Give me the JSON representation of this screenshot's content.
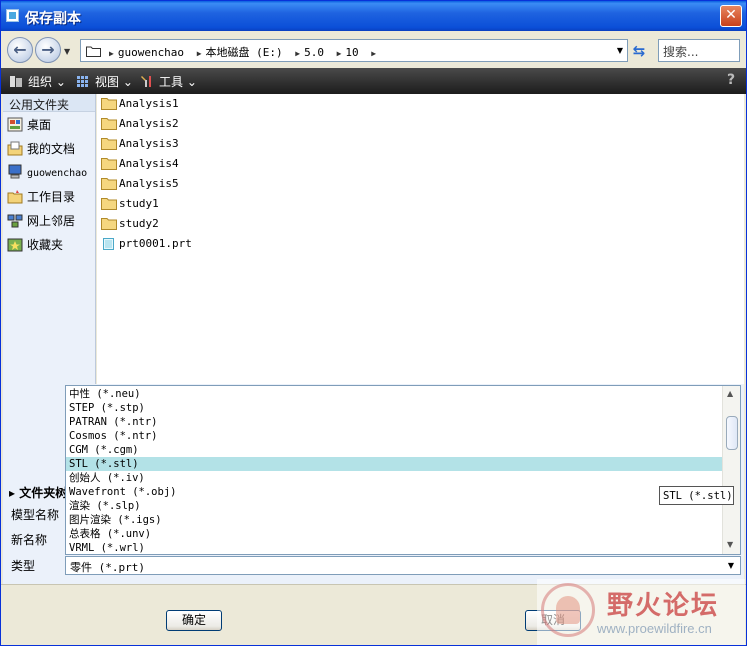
{
  "window": {
    "title": "保存副本"
  },
  "address": {
    "crumbs": [
      "guowenchao",
      "本地磁盘 (E:)",
      "5.0",
      "10"
    ],
    "search_placeholder": "搜索..."
  },
  "toolbar": {
    "organize": "组织",
    "views": "视图",
    "tools": "工具"
  },
  "sidebar": {
    "header": "公用文件夹",
    "items": [
      {
        "label": "桌面",
        "icon": "desktop-icon"
      },
      {
        "label": "我的文档",
        "icon": "my-documents-icon"
      },
      {
        "label": "guowenchao",
        "icon": "computer-icon"
      },
      {
        "label": "工作目录",
        "icon": "working-directory-icon"
      },
      {
        "label": "网上邻居",
        "icon": "network-icon"
      },
      {
        "label": "收藏夹",
        "icon": "favorites-icon"
      }
    ]
  },
  "files": [
    {
      "name": "Analysis1",
      "type": "folder"
    },
    {
      "name": "Analysis2",
      "type": "folder"
    },
    {
      "name": "Analysis3",
      "type": "folder"
    },
    {
      "name": "Analysis4",
      "type": "folder"
    },
    {
      "name": "Analysis5",
      "type": "folder"
    },
    {
      "name": "study1",
      "type": "folder"
    },
    {
      "name": "study2",
      "type": "folder"
    },
    {
      "name": "prt0001.prt",
      "type": "part"
    }
  ],
  "form": {
    "folder_tree_label": "文件夹树",
    "model_name_label": "模型名称",
    "new_name_label": "新名称",
    "type_label": "类型",
    "type_value": "零件 (*.prt)"
  },
  "type_options": [
    "中性 (*.neu)",
    "STEP (*.stp)",
    "PATRAN (*.ntr)",
    "Cosmos (*.ntr)",
    "CGM (*.cgm)",
    "STL (*.stl)",
    "创始人 (*.iv)",
    "Wavefront (*.obj)",
    "渲染 (*.slp)",
    "图片渲染 (*.igs)",
    "总表格 (*.unv)",
    "VRML (*.wrl)"
  ],
  "selected_option_index": 5,
  "tooltip": "STL (*.stl)",
  "buttons": {
    "ok": "确定",
    "cancel": "取消"
  },
  "watermark": {
    "title": "野火论坛",
    "url": "www.proewildfire.cn"
  },
  "colors": {
    "titlebar": "#1f63e0",
    "selection": "#b3e2e7",
    "toolbar": "#2a2a2a"
  }
}
